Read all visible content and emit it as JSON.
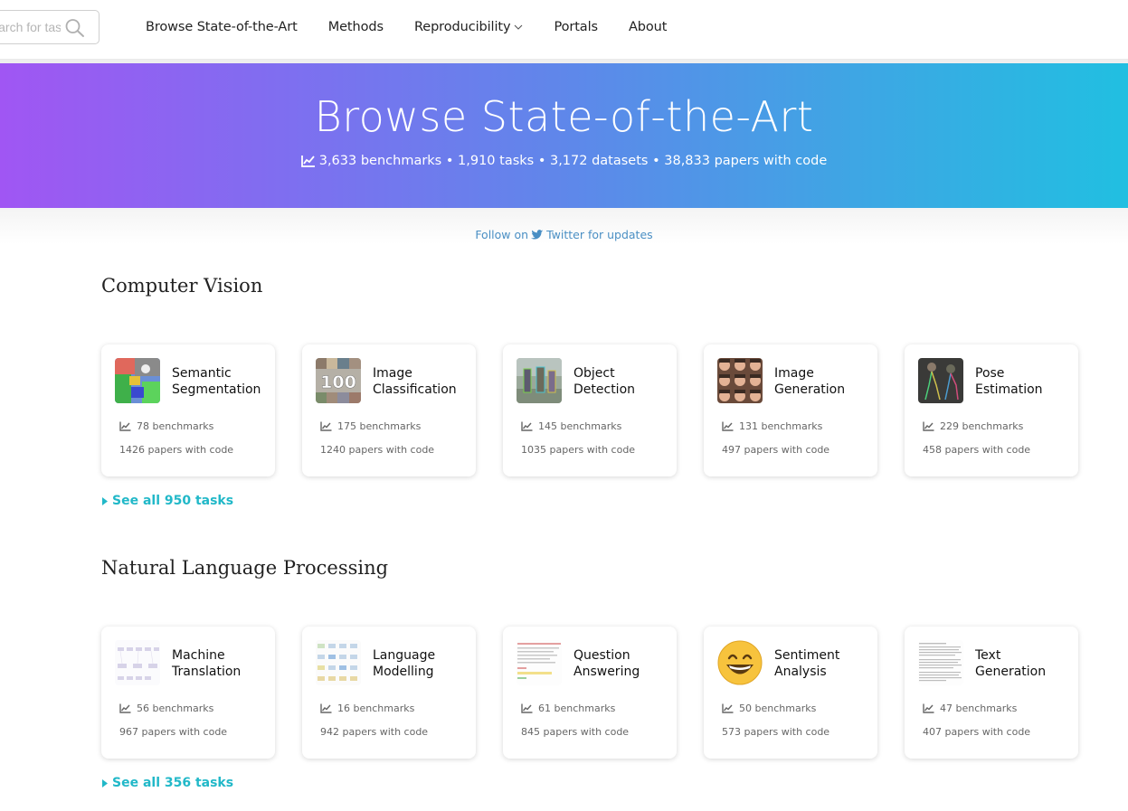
{
  "nav": {
    "search_placeholder": "Search for tasks",
    "links": [
      {
        "label": "Browse State-of-the-Art"
      },
      {
        "label": "Methods"
      },
      {
        "label": "Reproducibility",
        "has_dropdown": true
      },
      {
        "label": "Portals"
      },
      {
        "label": "About"
      }
    ]
  },
  "hero": {
    "title": "Browse State-of-the-Art",
    "stats": "3,633 benchmarks • 1,910 tasks • 3,172 datasets • 38,833 papers with code",
    "gradient": [
      "#a056f3",
      "#21bfe1"
    ]
  },
  "follow": {
    "prefix": "Follow on",
    "suffix": "Twitter for updates"
  },
  "sections": [
    {
      "title": "Computer Vision",
      "see_all": "See all 950 tasks",
      "cards": [
        {
          "name": "Semantic Segmentation",
          "benchmarks": "78 benchmarks",
          "papers": "1426 papers with code"
        },
        {
          "name": "Image Classification",
          "benchmarks": "175 benchmarks",
          "papers": "1240 papers with code"
        },
        {
          "name": "Object Detection",
          "benchmarks": "145 benchmarks",
          "papers": "1035 papers with code"
        },
        {
          "name": "Image Generation",
          "benchmarks": "131 benchmarks",
          "papers": "497 papers with code"
        },
        {
          "name": "Pose Estimation",
          "benchmarks": "229 benchmarks",
          "papers": "458 papers with code"
        }
      ]
    },
    {
      "title": "Natural Language Processing",
      "see_all": "See all 356 tasks",
      "cards": [
        {
          "name": "Machine Translation",
          "benchmarks": "56 benchmarks",
          "papers": "967 papers with code"
        },
        {
          "name": "Language Modelling",
          "benchmarks": "16 benchmarks",
          "papers": "942 papers with code"
        },
        {
          "name": "Question Answering",
          "benchmarks": "61 benchmarks",
          "papers": "845 papers with code"
        },
        {
          "name": "Sentiment Analysis",
          "benchmarks": "50 benchmarks",
          "papers": "573 papers with code"
        },
        {
          "name": "Text Generation",
          "benchmarks": "47 benchmarks",
          "papers": "407 papers with code"
        }
      ]
    }
  ],
  "colors": {
    "accent": "#21b8c8",
    "link_blue": "#4a8fc4"
  }
}
